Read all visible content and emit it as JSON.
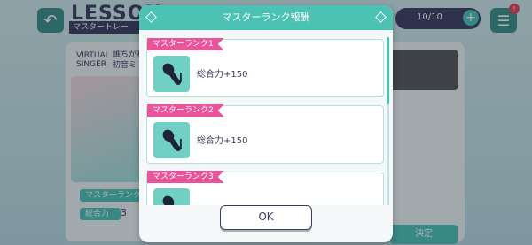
{
  "background": {
    "title": "LESSON",
    "subtitle": "マスタートレー",
    "stamina": "10/10",
    "notification_count": "!",
    "virtual_singer": "VIRTUAL SINGER",
    "char_line1": "誰ちが初",
    "char_line2": "初音ミ",
    "pill1": "マスターランク",
    "pill2": "総合力",
    "value": "3",
    "decide": "決定"
  },
  "modal": {
    "title": "マスターランク報酬",
    "items": [
      {
        "rank": "マスターランク1",
        "reward": "総合力+150",
        "icon": "microphone-note-icon"
      },
      {
        "rank": "マスターランク2",
        "reward": "総合力+150",
        "icon": "microphone-note-icon"
      },
      {
        "rank": "マスターランク3",
        "reward": "",
        "icon": "microphone-note-icon"
      }
    ],
    "ok_label": "OK"
  },
  "colors": {
    "accent": "#4cc2b5",
    "tag": "#e8559a",
    "text": "#3c3d5e"
  }
}
